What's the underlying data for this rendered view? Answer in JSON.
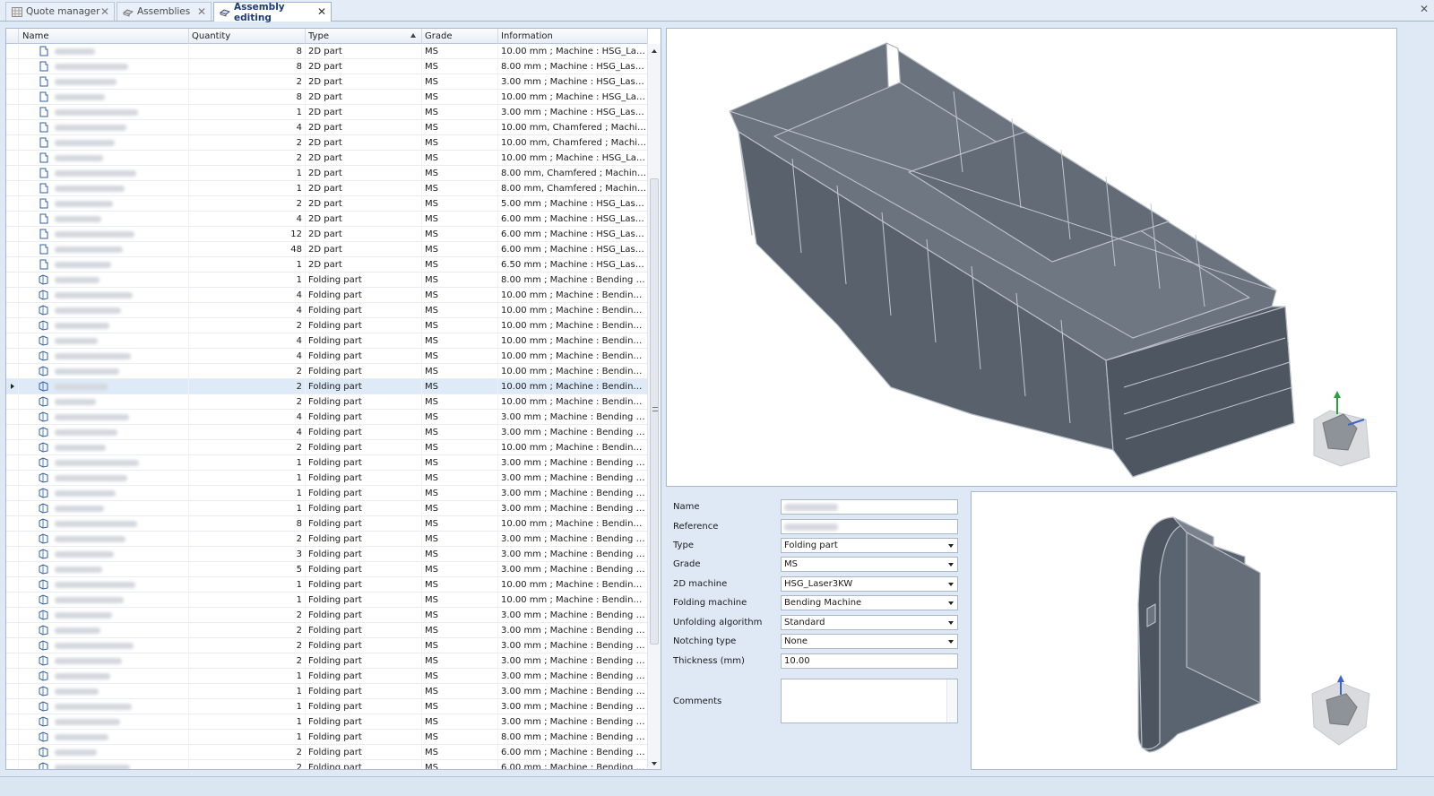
{
  "tabs": [
    {
      "label": "Quote manager",
      "icon": "grid-icon",
      "active": false
    },
    {
      "label": "Assemblies",
      "icon": "assembly-icon",
      "active": false
    },
    {
      "label": "Assembly editing",
      "icon": "assembly-edit-icon",
      "active": true
    }
  ],
  "grid": {
    "columns": {
      "name": "Name",
      "quantity": "Quantity",
      "type": "Type",
      "grade": "Grade",
      "information": "Information"
    },
    "sorted_column": "Type",
    "selected_row": 22,
    "rows": [
      {
        "qty": "8",
        "type": "2D part",
        "grade": "MS",
        "info": "10.00 mm ; Machine : HSG_Laser3KW"
      },
      {
        "qty": "8",
        "type": "2D part",
        "grade": "MS",
        "info": "8.00 mm ; Machine : HSG_Laser3KW"
      },
      {
        "qty": "2",
        "type": "2D part",
        "grade": "MS",
        "info": "3.00 mm ; Machine : HSG_Laser3KW"
      },
      {
        "qty": "8",
        "type": "2D part",
        "grade": "MS",
        "info": "10.00 mm ; Machine : HSG_Laser3KW"
      },
      {
        "qty": "1",
        "type": "2D part",
        "grade": "MS",
        "info": "3.00 mm ; Machine : HSG_Laser3KW"
      },
      {
        "qty": "4",
        "type": "2D part",
        "grade": "MS",
        "info": "10.00 mm, Chamfered ; Machine : H..."
      },
      {
        "qty": "2",
        "type": "2D part",
        "grade": "MS",
        "info": "10.00 mm, Chamfered ; Machine : H..."
      },
      {
        "qty": "2",
        "type": "2D part",
        "grade": "MS",
        "info": "10.00 mm ; Machine : HSG_Laser3KW"
      },
      {
        "qty": "1",
        "type": "2D part",
        "grade": "MS",
        "info": "8.00 mm, Chamfered ; Machine : HS..."
      },
      {
        "qty": "1",
        "type": "2D part",
        "grade": "MS",
        "info": "8.00 mm, Chamfered ; Machine : HS..."
      },
      {
        "qty": "2",
        "type": "2D part",
        "grade": "MS",
        "info": "5.00 mm ; Machine : HSG_Laser3KW"
      },
      {
        "qty": "4",
        "type": "2D part",
        "grade": "MS",
        "info": "6.00 mm ; Machine : HSG_Laser3KW"
      },
      {
        "qty": "12",
        "type": "2D part",
        "grade": "MS",
        "info": "6.00 mm ; Machine : HSG_Laser3KW"
      },
      {
        "qty": "48",
        "type": "2D part",
        "grade": "MS",
        "info": "6.00 mm ; Machine : HSG_Laser3KW"
      },
      {
        "qty": "1",
        "type": "2D part",
        "grade": "MS",
        "info": "6.50 mm ; Machine : HSG_Laser3KW"
      },
      {
        "qty": "1",
        "type": "Folding part",
        "grade": "MS",
        "info": "8.00 mm ; Machine : Bending Machine"
      },
      {
        "qty": "4",
        "type": "Folding part",
        "grade": "MS",
        "info": "10.00 mm ; Machine : Bending Machi..."
      },
      {
        "qty": "4",
        "type": "Folding part",
        "grade": "MS",
        "info": "10.00 mm ; Machine : Bending Machi..."
      },
      {
        "qty": "2",
        "type": "Folding part",
        "grade": "MS",
        "info": "10.00 mm ; Machine : Bending Machi..."
      },
      {
        "qty": "4",
        "type": "Folding part",
        "grade": "MS",
        "info": "10.00 mm ; Machine : Bending Machi..."
      },
      {
        "qty": "4",
        "type": "Folding part",
        "grade": "MS",
        "info": "10.00 mm ; Machine : Bending Machi..."
      },
      {
        "qty": "2",
        "type": "Folding part",
        "grade": "MS",
        "info": "10.00 mm ; Machine : Bending Machi..."
      },
      {
        "qty": "2",
        "type": "Folding part",
        "grade": "MS",
        "info": "10.00 mm ; Machine : Bending Machi..."
      },
      {
        "qty": "2",
        "type": "Folding part",
        "grade": "MS",
        "info": "10.00 mm ; Machine : Bending Machi..."
      },
      {
        "qty": "4",
        "type": "Folding part",
        "grade": "MS",
        "info": "3.00 mm ; Machine : Bending Machine"
      },
      {
        "qty": "4",
        "type": "Folding part",
        "grade": "MS",
        "info": "3.00 mm ; Machine : Bending Machine"
      },
      {
        "qty": "2",
        "type": "Folding part",
        "grade": "MS",
        "info": "10.00 mm ; Machine : Bending Machi..."
      },
      {
        "qty": "1",
        "type": "Folding part",
        "grade": "MS",
        "info": "3.00 mm ; Machine : Bending Machine"
      },
      {
        "qty": "1",
        "type": "Folding part",
        "grade": "MS",
        "info": "3.00 mm ; Machine : Bending Machine"
      },
      {
        "qty": "1",
        "type": "Folding part",
        "grade": "MS",
        "info": "3.00 mm ; Machine : Bending Machine"
      },
      {
        "qty": "1",
        "type": "Folding part",
        "grade": "MS",
        "info": "3.00 mm ; Machine : Bending Machine"
      },
      {
        "qty": "8",
        "type": "Folding part",
        "grade": "MS",
        "info": "10.00 mm ; Machine : Bending Machi..."
      },
      {
        "qty": "2",
        "type": "Folding part",
        "grade": "MS",
        "info": "3.00 mm ; Machine : Bending Machine"
      },
      {
        "qty": "3",
        "type": "Folding part",
        "grade": "MS",
        "info": "3.00 mm ; Machine : Bending Machine"
      },
      {
        "qty": "5",
        "type": "Folding part",
        "grade": "MS",
        "info": "3.00 mm ; Machine : Bending Machine"
      },
      {
        "qty": "1",
        "type": "Folding part",
        "grade": "MS",
        "info": "10.00 mm ; Machine : Bending Machi..."
      },
      {
        "qty": "1",
        "type": "Folding part",
        "grade": "MS",
        "info": "10.00 mm ; Machine : Bending Machi..."
      },
      {
        "qty": "2",
        "type": "Folding part",
        "grade": "MS",
        "info": "3.00 mm ; Machine : Bending Machine"
      },
      {
        "qty": "2",
        "type": "Folding part",
        "grade": "MS",
        "info": "3.00 mm ; Machine : Bending Machine"
      },
      {
        "qty": "2",
        "type": "Folding part",
        "grade": "MS",
        "info": "3.00 mm ; Machine : Bending Machine"
      },
      {
        "qty": "2",
        "type": "Folding part",
        "grade": "MS",
        "info": "3.00 mm ; Machine : Bending Machine"
      },
      {
        "qty": "1",
        "type": "Folding part",
        "grade": "MS",
        "info": "3.00 mm ; Machine : Bending Machine"
      },
      {
        "qty": "1",
        "type": "Folding part",
        "grade": "MS",
        "info": "3.00 mm ; Machine : Bending Machine"
      },
      {
        "qty": "1",
        "type": "Folding part",
        "grade": "MS",
        "info": "3.00 mm ; Machine : Bending Machine"
      },
      {
        "qty": "1",
        "type": "Folding part",
        "grade": "MS",
        "info": "3.00 mm ; Machine : Bending Machine"
      },
      {
        "qty": "1",
        "type": "Folding part",
        "grade": "MS",
        "info": "8.00 mm ; Machine : Bending Machine"
      },
      {
        "qty": "2",
        "type": "Folding part",
        "grade": "MS",
        "info": "6.00 mm ; Machine : Bending Machine"
      },
      {
        "qty": "2",
        "type": "Folding part",
        "grade": "MS",
        "info": "6.00 mm ; Machine : Bending Machine"
      }
    ]
  },
  "properties": {
    "name_label": "Name",
    "reference_label": "Reference",
    "type_label": "Type",
    "type_value": "Folding part",
    "grade_label": "Grade",
    "grade_value": "MS",
    "machine2d_label": "2D machine",
    "machine2d_value": "HSG_Laser3KW",
    "folding_machine_label": "Folding machine",
    "folding_machine_value": "Bending Machine",
    "unfolding_label": "Unfolding algorithm",
    "unfolding_value": "Standard",
    "notching_label": "Notching type",
    "notching_value": "None",
    "thickness_label": "Thickness (mm)",
    "thickness_value": "10.00",
    "comments_label": "Comments",
    "comments_value": ""
  },
  "colors": {
    "model_fill": "#5a6470",
    "model_edge": "#b8bec6",
    "tab_active_text": "#1b3a7a"
  }
}
